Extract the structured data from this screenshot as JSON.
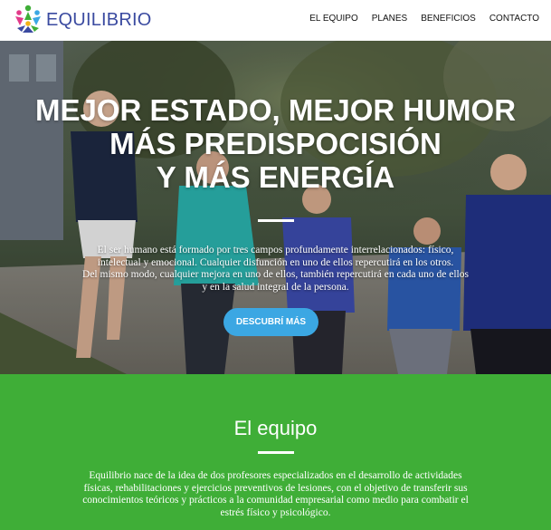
{
  "header": {
    "logo_text": "EQUILIBRIO",
    "nav": [
      {
        "label": "EL EQUIPO"
      },
      {
        "label": "PLANES"
      },
      {
        "label": "BENEFICIOS"
      },
      {
        "label": "CONTACTO"
      }
    ]
  },
  "hero": {
    "title_lines": [
      "MEJOR ESTADO, MEJOR HUMOR",
      "MÁS PREDISPOCISIÓN",
      "Y MÁS ENERGÍA"
    ],
    "text_lines": [
      "El ser humano está formado por tres campos profundamente interrelacionados: físico,",
      "intelectual y emocional. Cualquier disfunción en uno de ellos repercutirá en los otros.",
      "Del mismo modo, cualquier mejora en uno de ellos, también repercutirá en cada uno de ellos",
      "y en la salud integral de la persona."
    ],
    "button_label": "DESCUBRÍ MÁS"
  },
  "equipo": {
    "title": "El equipo",
    "text_lines": [
      "Equilibrio nace de la idea de dos profesores especializados en el desarrollo de actividades",
      "físicas, rehabilitaciones y ejercicios preventivos de lesiones, con el objetivo de transferir sus",
      "conocimientos teóricos y prácticos a la comunidad empresarial como medio para combatir el",
      "estrés físico y psicológico."
    ]
  },
  "colors": {
    "brand_blue": "#3a4aa0",
    "button_blue": "#3ba7e3",
    "section_green": "#3fae37"
  }
}
